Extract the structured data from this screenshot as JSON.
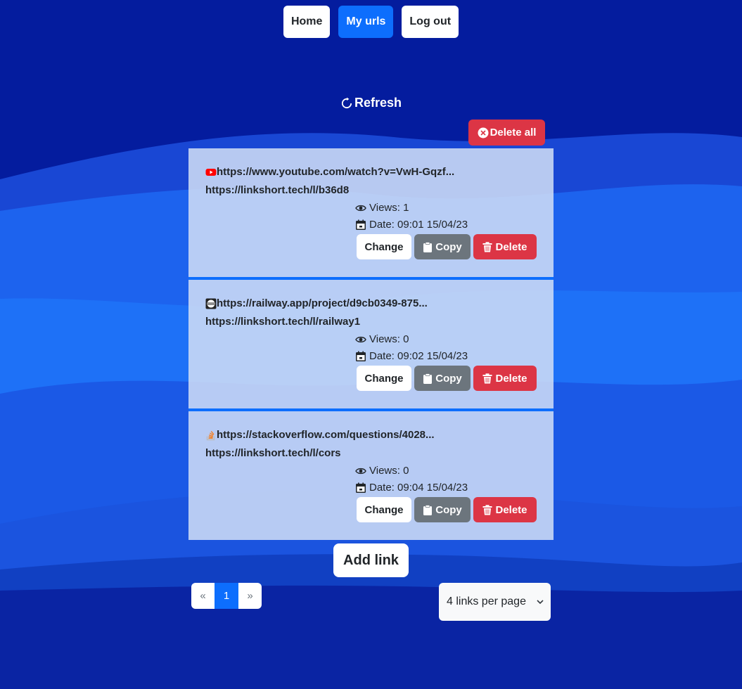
{
  "nav": {
    "home": "Home",
    "my_urls": "My urls",
    "logout": "Log out"
  },
  "toolbar": {
    "refresh": "Refresh",
    "delete_all": "Delete all"
  },
  "links": [
    {
      "favicon": "youtube-icon",
      "original": "https://www.youtube.com/watch?v=VwH-Gqzf...",
      "short": "https://linkshort.tech/l/b36d8",
      "views": "Views: 1",
      "date": "Date: 09:01 15/04/23"
    },
    {
      "favicon": "railway-icon",
      "original": "https://railway.app/project/d9cb0349-875...",
      "short": "https://linkshort.tech/l/railway1",
      "views": "Views: 0",
      "date": "Date: 09:02 15/04/23"
    },
    {
      "favicon": "stackoverflow-icon",
      "original": "https://stackoverflow.com/questions/4028...",
      "short": "https://linkshort.tech/l/cors",
      "views": "Views: 0",
      "date": "Date: 09:04 15/04/23"
    }
  ],
  "actions": {
    "change": "Change",
    "copy": "Copy",
    "delete": "Delete"
  },
  "add_link": "Add link",
  "pagination": {
    "prev": "«",
    "current": "1",
    "next": "»"
  },
  "per_page": {
    "selected": "4 links per page"
  },
  "colors": {
    "background": "#0a1f9c",
    "primary": "#0d6efd",
    "danger": "#dc3545",
    "secondary": "#6c757d"
  }
}
